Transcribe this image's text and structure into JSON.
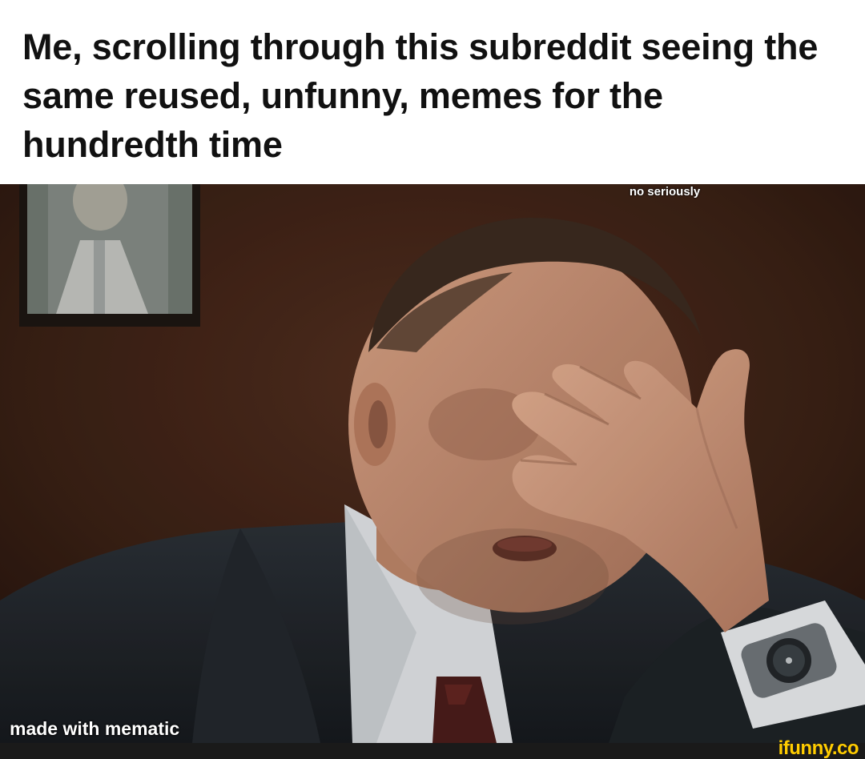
{
  "caption": {
    "text": "Me, scrolling through this subreddit seeing the same reused, unfunny, memes for the hundredth time"
  },
  "overlay": {
    "top_label": "no seriously",
    "bottom_watermark": "made with mematic"
  },
  "footer": {
    "logo": "ifunny.co"
  },
  "colors": {
    "caption_bg": "#ffffff",
    "caption_text": "#111111",
    "wall": "#3a1f14",
    "footer_bar": "#1a1a1a",
    "logo": "#ffcc00"
  }
}
